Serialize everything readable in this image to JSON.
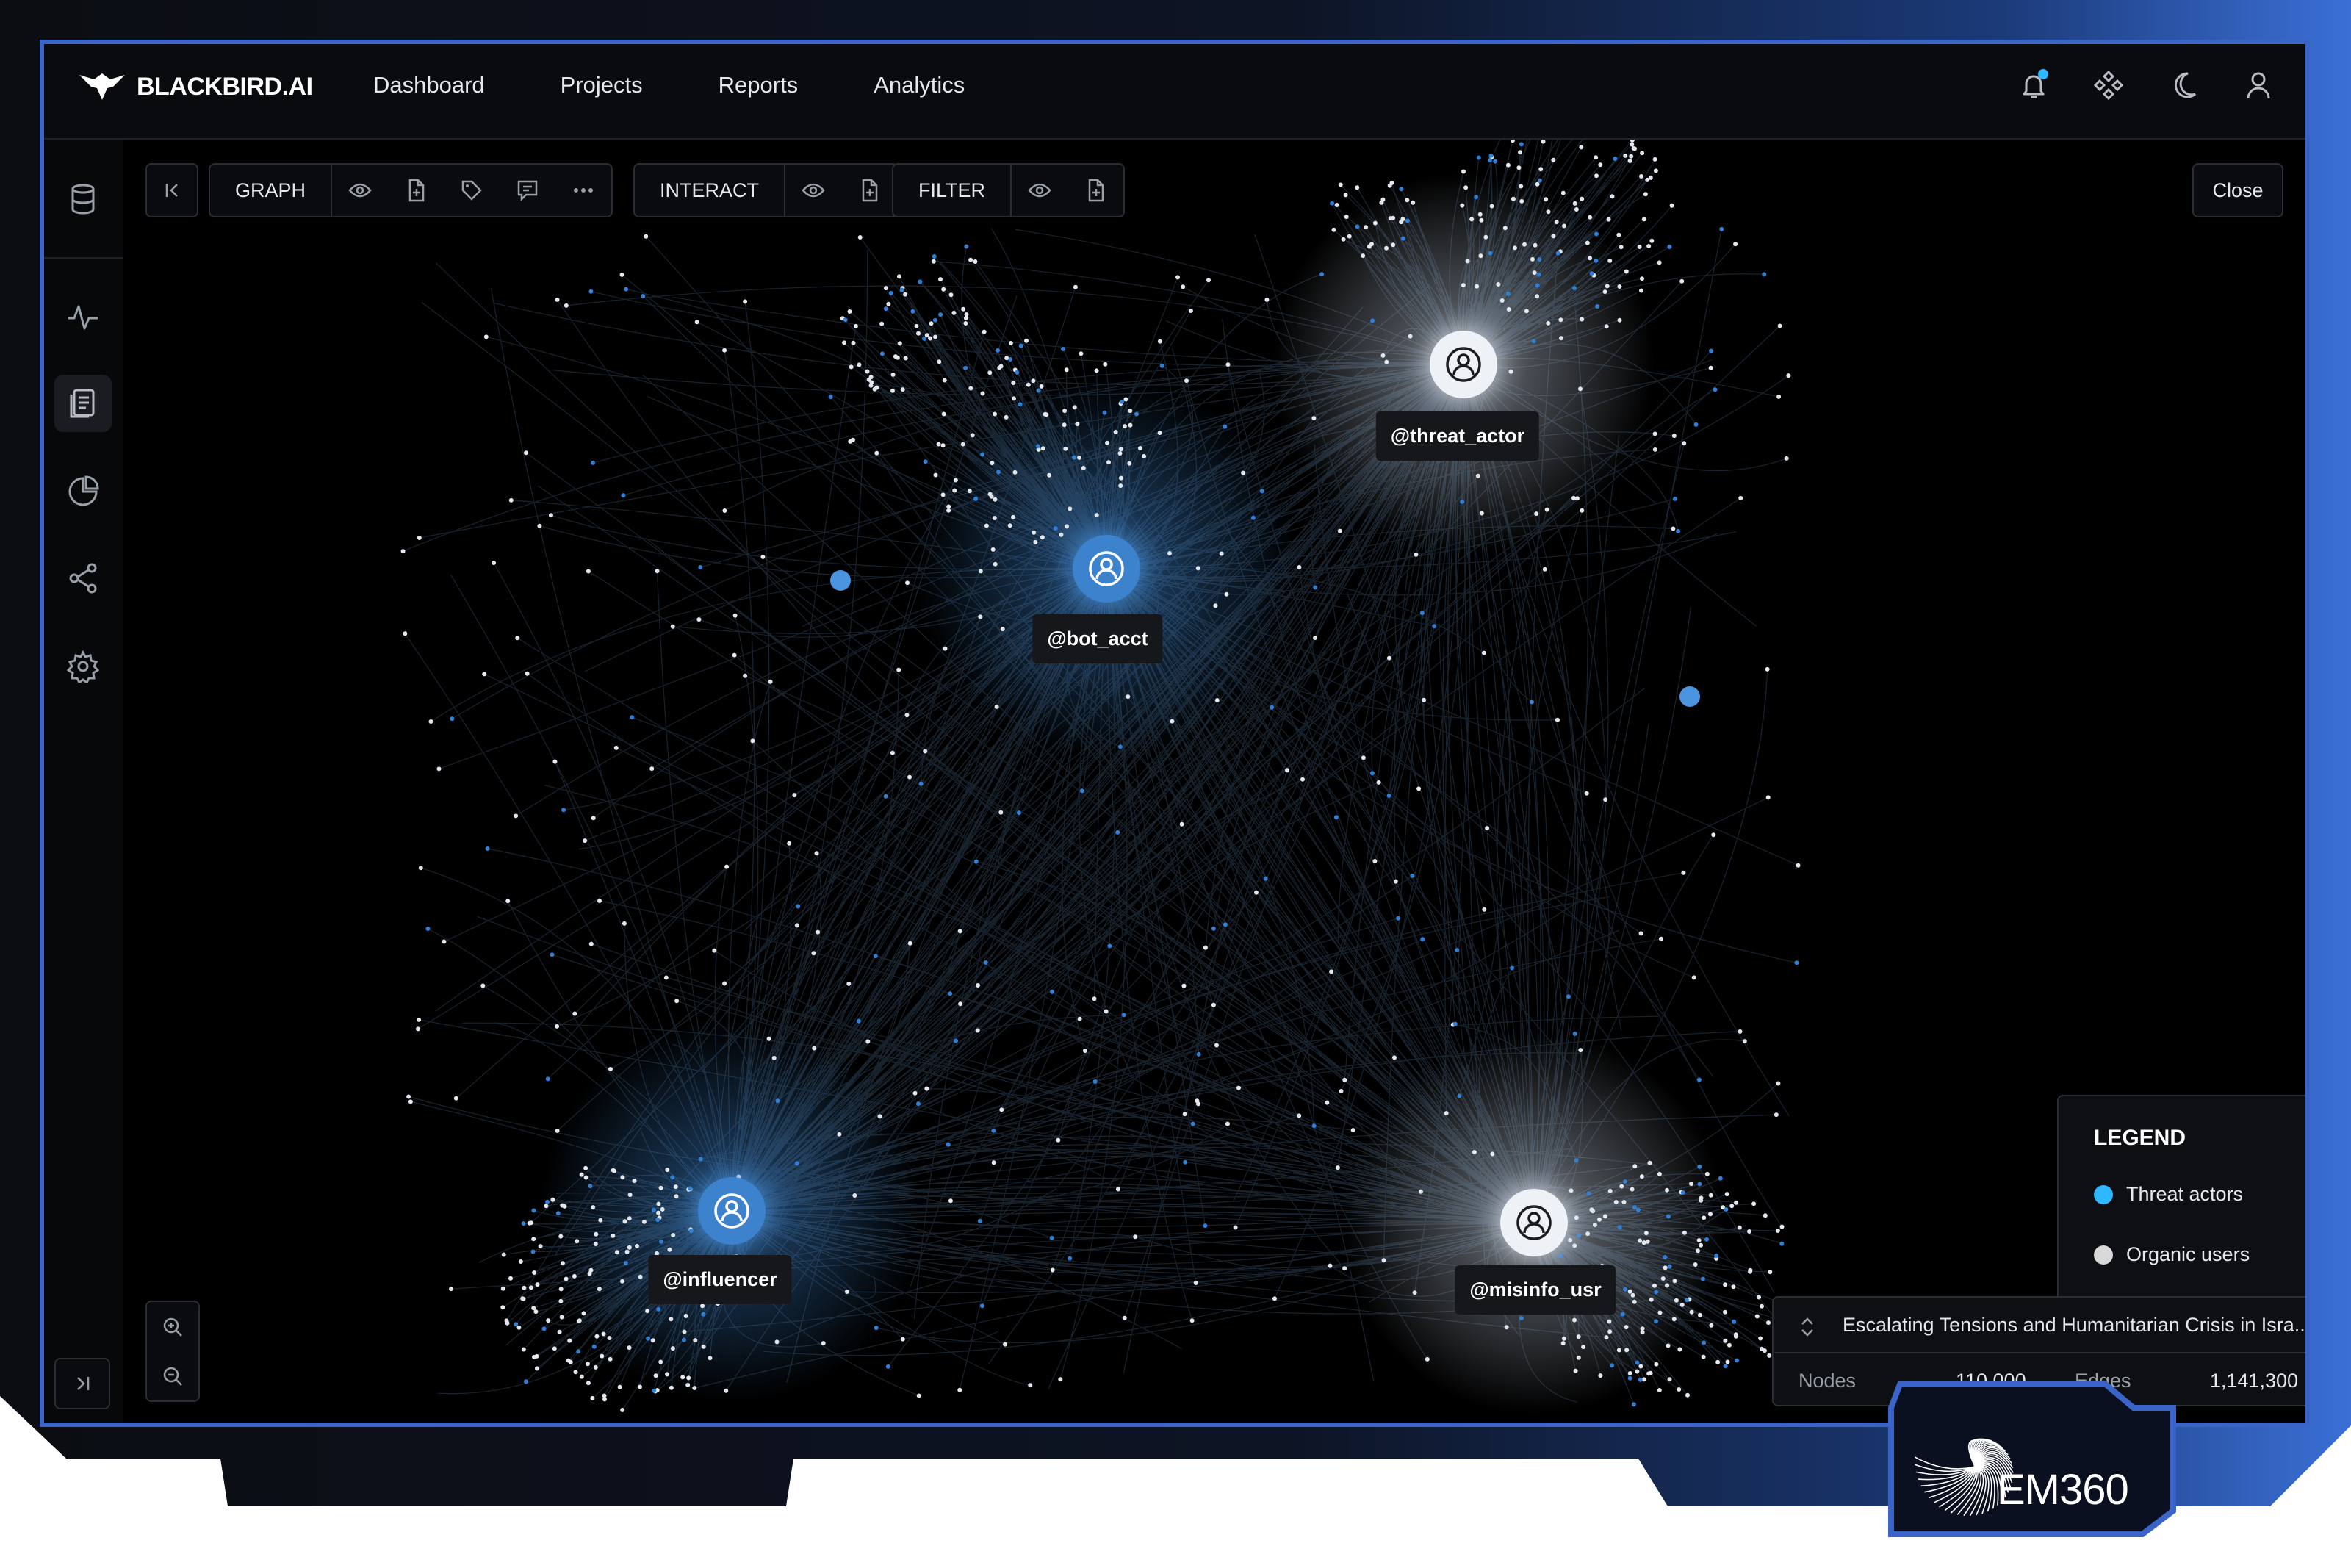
{
  "app": {
    "brand": "BLACKBIRD.AI",
    "nav": [
      "Dashboard",
      "Projects",
      "Reports",
      "Analytics"
    ],
    "top_icons": [
      "bell-icon",
      "apps-icon",
      "moon-icon",
      "user-icon"
    ]
  },
  "sidebar": {
    "icons": [
      "database-icon",
      "activity-icon",
      "document-icon",
      "pie-chart-icon",
      "share-icon",
      "settings-icon"
    ],
    "active": "document-icon"
  },
  "toolbar": {
    "graph_label": "GRAPH",
    "interact_label": "INTERACT",
    "filter_label": "FILTER",
    "close_label": "Close"
  },
  "graph": {
    "hubs": [
      {
        "label": "@bot_acct",
        "type": "threat"
      },
      {
        "label": "@threat_actor",
        "type": "organic"
      },
      {
        "label": "@influencer",
        "type": "threat"
      },
      {
        "label": "@misinfo_usr",
        "type": "organic"
      }
    ]
  },
  "legend": {
    "title": "LEGEND",
    "items": [
      {
        "label": "Threat actors",
        "color": "#2fb8ff"
      },
      {
        "label": "Organic users",
        "color": "#d9d9d9"
      }
    ]
  },
  "info": {
    "title": "Escalating Tensions and Humanitarian Crisis in Isra...",
    "nodes_label": "Nodes",
    "nodes_value": "110,000",
    "edges_label": "Edges",
    "edges_value": "1,141,300"
  },
  "badge": {
    "text": "EM360"
  },
  "colors": {
    "accent": "#3a64c8",
    "threat": "#2fb8ff",
    "organic": "#d9d9d9"
  }
}
